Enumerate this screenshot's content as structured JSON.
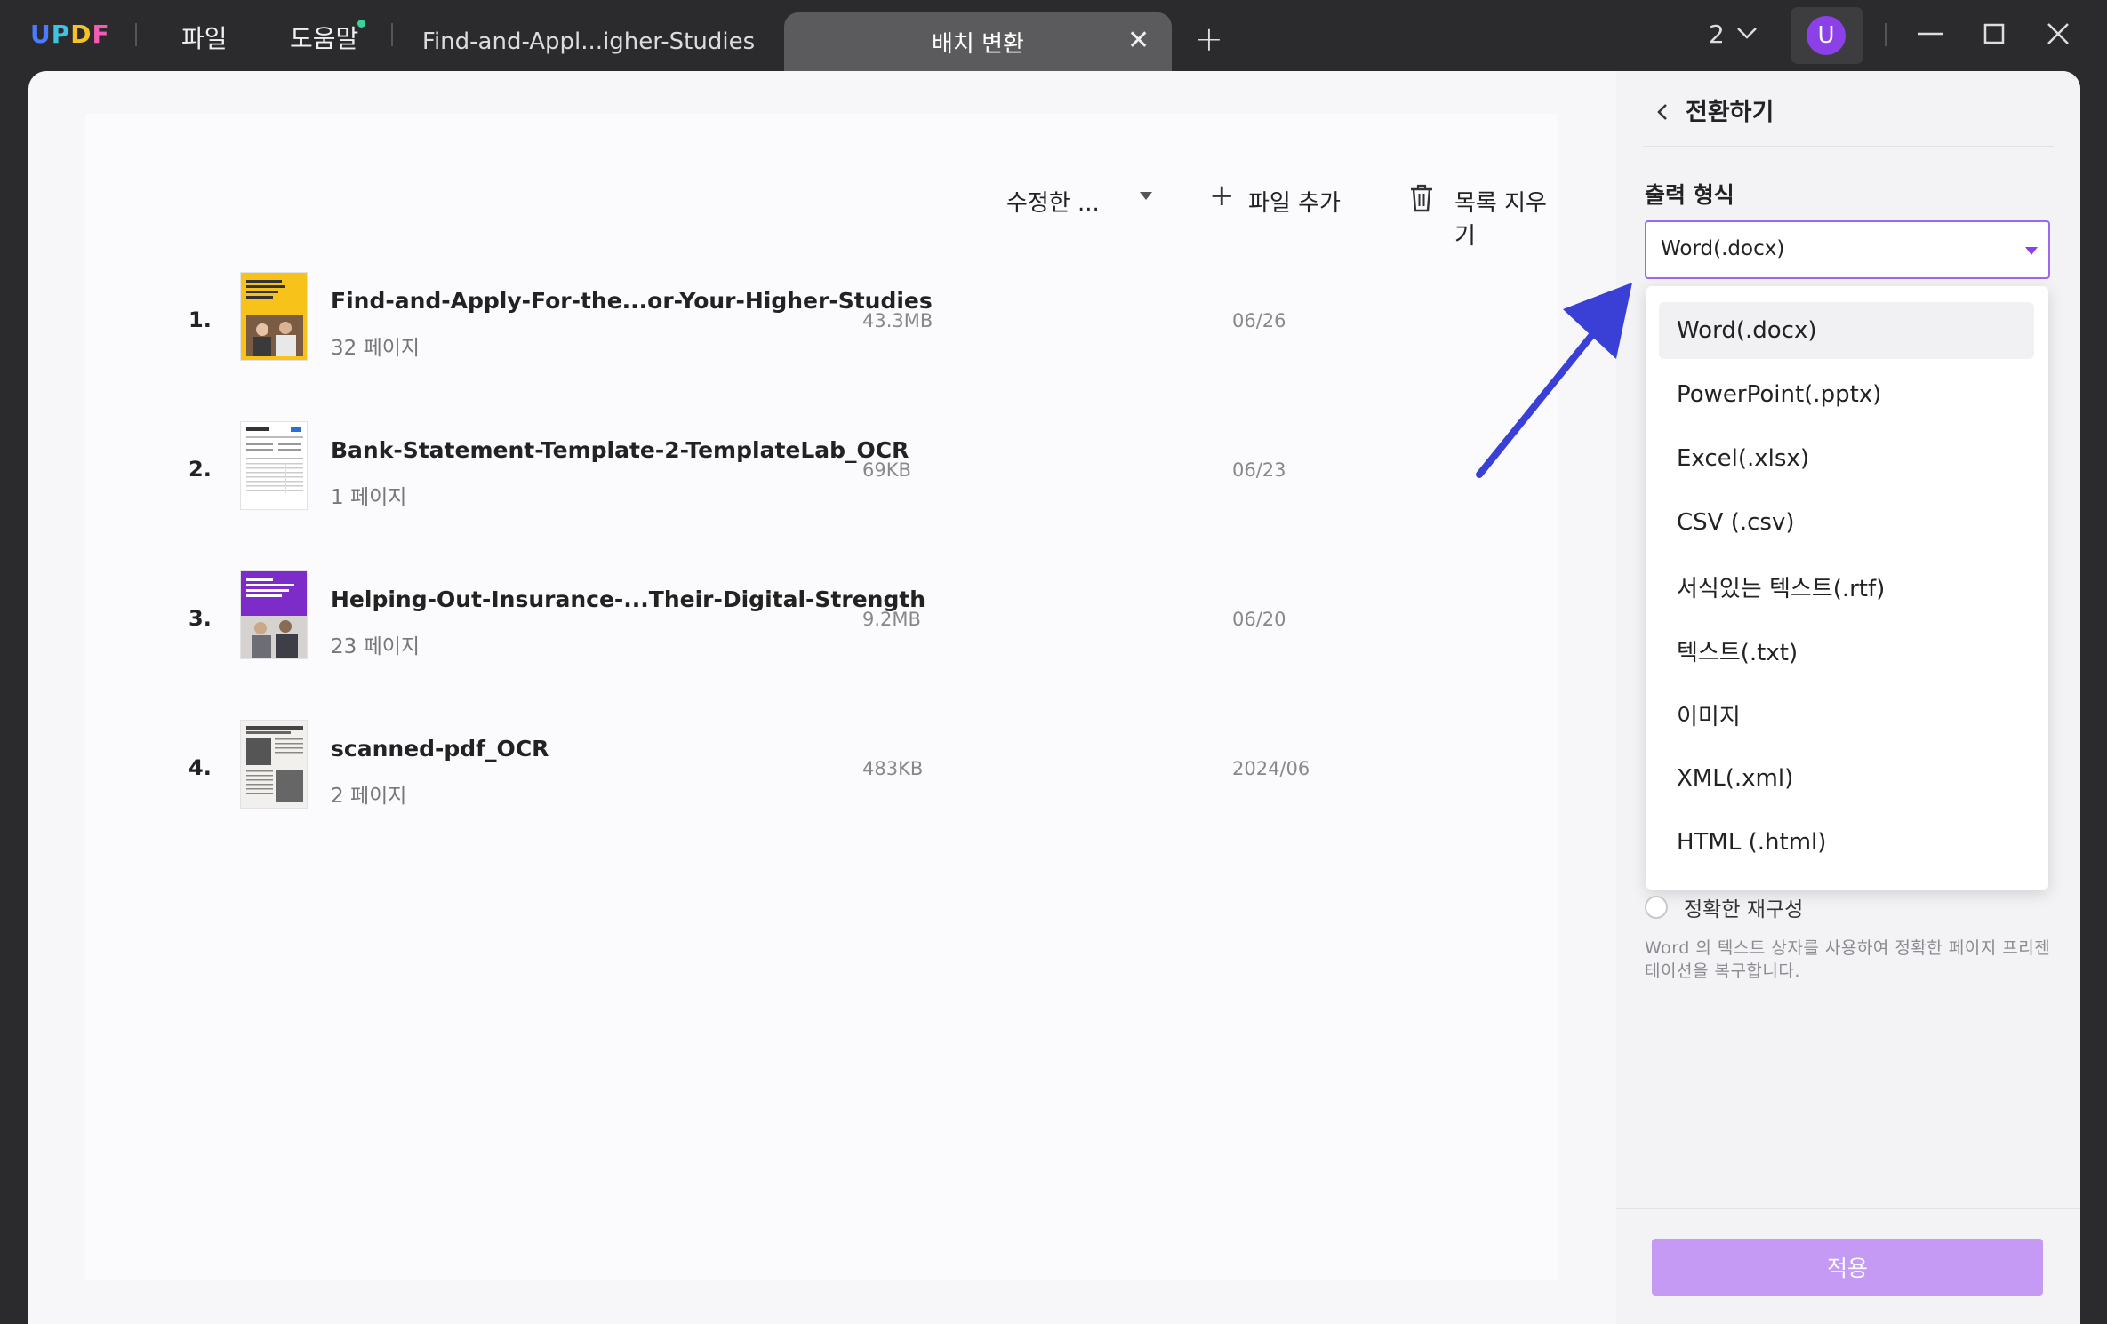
{
  "app": {
    "logo": "UPDF",
    "menu_file": "파일",
    "menu_help": "도움말",
    "tabs": [
      {
        "label": "Find-and-Appl...igher-Studies"
      },
      {
        "label": "배치 변환"
      }
    ],
    "window_count": "2",
    "avatar_letter": "U"
  },
  "toolbar": {
    "sort_label": "수정한 ...",
    "add_file_label": "파일 추가",
    "clear_list_label": "목록 지우기"
  },
  "files": [
    {
      "num": "1.",
      "name": "Find-and-Apply-For-the...or-Your-Higher-Studies",
      "pages": "32 페이지",
      "size": "43.3MB",
      "date": "06/26"
    },
    {
      "num": "2.",
      "name": "Bank-Statement-Template-2-TemplateLab_OCR",
      "pages": "1 페이지",
      "size": "69KB",
      "date": "06/23"
    },
    {
      "num": "3.",
      "name": "Helping-Out-Insurance-...Their-Digital-Strength",
      "pages": "23 페이지",
      "size": "9.2MB",
      "date": "06/20"
    },
    {
      "num": "4.",
      "name": "scanned-pdf_OCR",
      "pages": "2 페이지",
      "size": "483KB",
      "date": "2024/06"
    }
  ],
  "panel": {
    "title": "전환하기",
    "output_format_label": "출력 형식",
    "selected_format": "Word(.docx)",
    "format_options": [
      "Word(.docx)",
      "PowerPoint(.pptx)",
      "Excel(.xlsx)",
      "CSV (.csv)",
      "서식있는 텍스트(.rtf)",
      "텍스트(.txt)",
      "이미지",
      "XML(.xml)",
      "HTML (.html)"
    ],
    "radio_label": "정확한 재구성",
    "radio_desc": "Word 의 텍스트 상자를 사용하여 정확한 페이지 프리젠테이션을 복구합니다.",
    "apply_label": "적용"
  },
  "colors": {
    "accent": "#8b40e8",
    "apply_button": "#c49af5",
    "annotation_arrow": "#3a3fd6"
  }
}
